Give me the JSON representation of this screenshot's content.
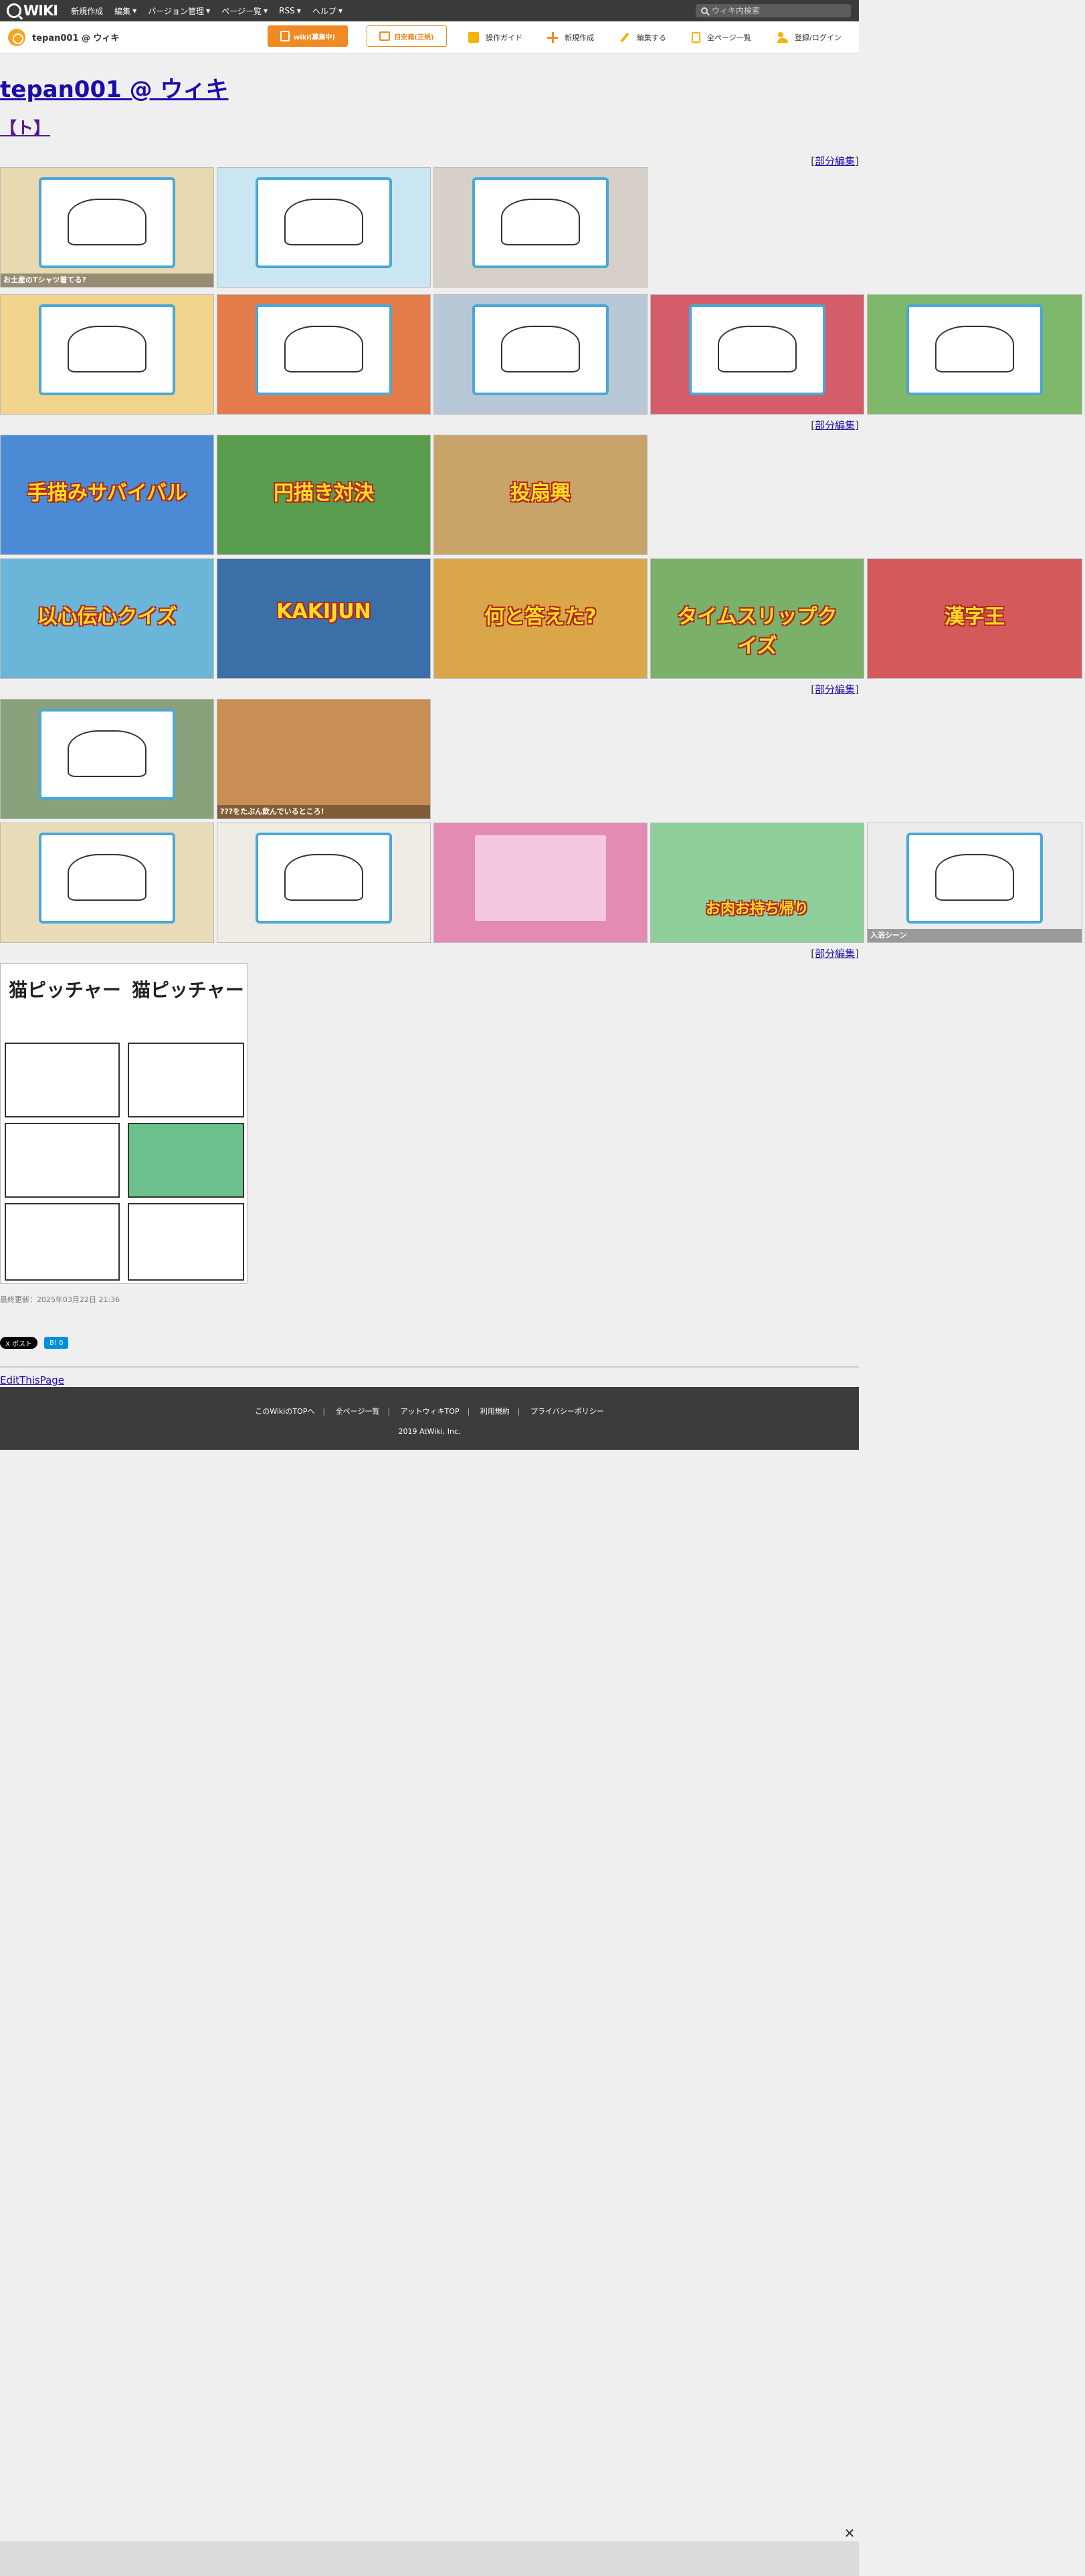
{
  "topbar": {
    "logo": "WIKI",
    "menu": [
      {
        "label": "新規作成"
      },
      {
        "label": "編集"
      },
      {
        "label": "バージョン管理"
      },
      {
        "label": "ページ一覧"
      },
      {
        "label": "RSS"
      },
      {
        "label": "ヘルプ"
      }
    ],
    "search_placeholder": "ウィキ内検索"
  },
  "subbar": {
    "wiki_name": "tepan001 @ ウィキ",
    "btn_primary": "wiki(募集中)",
    "btn_secondary": "目安箱(正規)",
    "tools": [
      {
        "label": "操作ガイド"
      },
      {
        "label": "新規作成"
      },
      {
        "label": "編集する"
      },
      {
        "label": "全ページ一覧"
      },
      {
        "label": "登録/ログイン"
      }
    ]
  },
  "main": {
    "title": "tepan001 @ ウィキ",
    "section": "【ト】",
    "part_edit": "部分編集",
    "gallery1": [
      {
        "caption": "お土産のTシャツ着てる?"
      },
      {
        "caption": ""
      },
      {
        "caption": ""
      },
      {
        "caption": ""
      },
      {
        "caption": ""
      },
      {
        "caption": ""
      },
      {
        "caption": ""
      },
      {
        "caption": ""
      }
    ],
    "gallery2": [
      {
        "banner": "手描みサバイバル"
      },
      {
        "banner": "円描き対決"
      },
      {
        "banner": "投扇興"
      },
      {
        "banner": "以心伝心クイズ"
      },
      {
        "banner": "KAKIJUN"
      },
      {
        "banner": "何と答えた?"
      },
      {
        "banner": "タイムスリップクイズ"
      },
      {
        "banner": "漢字王"
      }
    ],
    "gallery3": [
      {
        "caption": ""
      },
      {
        "caption": "???をたぶん飲んでいるところ!"
      },
      {
        "caption": ""
      },
      {
        "caption": ""
      },
      {
        "caption": ""
      },
      {
        "caption": "お肉お持ち帰り"
      },
      {
        "caption": "入浴シーン"
      }
    ],
    "comic_title_left": "猫ピッチャー",
    "comic_title_right": "猫ピッチャー",
    "last_update": "最終更新：2025年03月22日 21:36",
    "share_x": "X ポスト",
    "share_hatena": "B! 0",
    "edit_this": "EditThisPage"
  },
  "footer": {
    "links": [
      {
        "label": "このWikiのTOPへ"
      },
      {
        "label": "全ページ一覧"
      },
      {
        "label": "アットウィキTOP"
      },
      {
        "label": "利用規約"
      },
      {
        "label": "プライバシーポリシー"
      }
    ],
    "copyright": "2019 AtWiki, Inc."
  },
  "colors": {
    "accent": "#f08a24",
    "topbar": "#3a3a3a",
    "link": "#1a0dab"
  }
}
